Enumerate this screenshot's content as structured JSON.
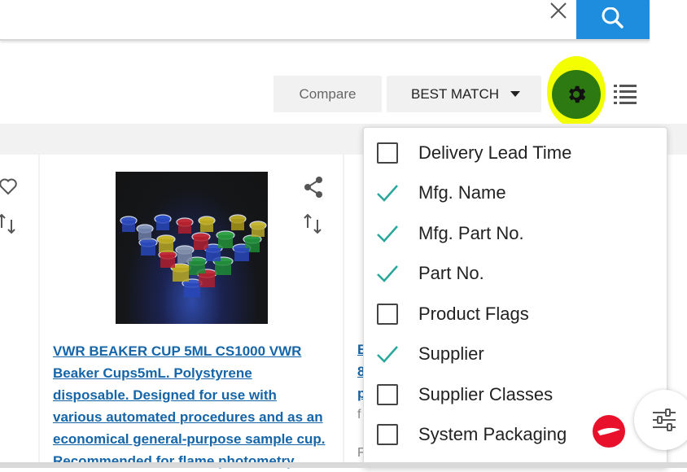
{
  "toolbar": {
    "compare_label": "Compare",
    "sort_label": "BEST MATCH"
  },
  "product": {
    "title_lines": [
      "VWR BEAKER CUP 5ML CS1000 VWR",
      "Beaker Cups5mL. Polystyrene",
      "disposable. Designed for use with",
      "various automated procedures and as an",
      "economical general-purpose sample cup.",
      "Recommended for flame photometry"
    ]
  },
  "next_product": {
    "fragments": [
      "B",
      "8",
      "p"
    ],
    "grey_fragments": [
      "f",
      "F"
    ]
  },
  "column_options": [
    {
      "label": "Delivery Lead Time",
      "checked": false
    },
    {
      "label": "Mfg. Name",
      "checked": true
    },
    {
      "label": "Mfg. Part No.",
      "checked": true
    },
    {
      "label": "Part No.",
      "checked": true
    },
    {
      "label": "Product Flags",
      "checked": false
    },
    {
      "label": "Supplier",
      "checked": true
    },
    {
      "label": "Supplier Classes",
      "checked": false
    },
    {
      "label": "System Packaging",
      "checked": false
    }
  ],
  "colors": {
    "accent_blue": "#1f8ddd",
    "check_teal": "#2aa69a",
    "settings_green": "#2d7a12",
    "highlight_yellow": "#f3ff00",
    "link_blue": "#1565a8"
  },
  "icons": {
    "clear": "close-icon",
    "search": "search-icon",
    "settings": "gear-icon",
    "list_view": "list-icon",
    "favorite": "heart-icon",
    "compare": "swap-icon",
    "share": "share-icon",
    "filter": "sliders-icon",
    "chat": "chat-icon"
  }
}
